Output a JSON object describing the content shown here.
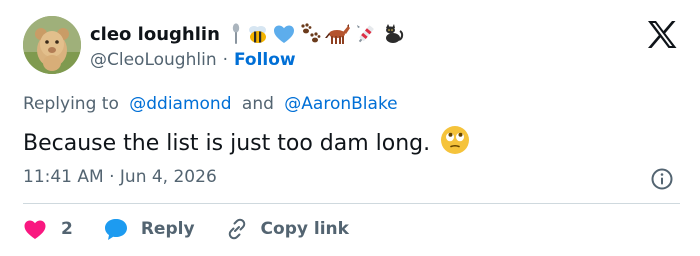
{
  "author": {
    "display_name": "cleo loughlin",
    "handle": "@CleoLoughlin",
    "separator": "·",
    "follow_label": "Follow",
    "name_emojis": [
      "spoon-icon",
      "bee-icon",
      "blue-heart-icon",
      "paw-prints-icon",
      "horse-icon",
      "firecracker-icon",
      "black-cat-icon"
    ]
  },
  "reply_context": {
    "prefix": "Replying to",
    "mention_1": "@ddiamond",
    "conjunction": "and",
    "mention_2": "@AaronBlake"
  },
  "tweet": {
    "text": "Because the list is just too dam long.",
    "emoji": "face-with-rolling-eyes-icon",
    "timestamp": "11:41 AM · Jun 4, 2026"
  },
  "actions": {
    "like_count": "2",
    "reply_label": "Reply",
    "copy_label": "Copy link"
  },
  "colors": {
    "text": "#0f1419",
    "secondary": "#536471",
    "link": "#006fd6",
    "like": "#f91880",
    "reply": "#1d9bf0",
    "divider": "#cfd9de"
  }
}
